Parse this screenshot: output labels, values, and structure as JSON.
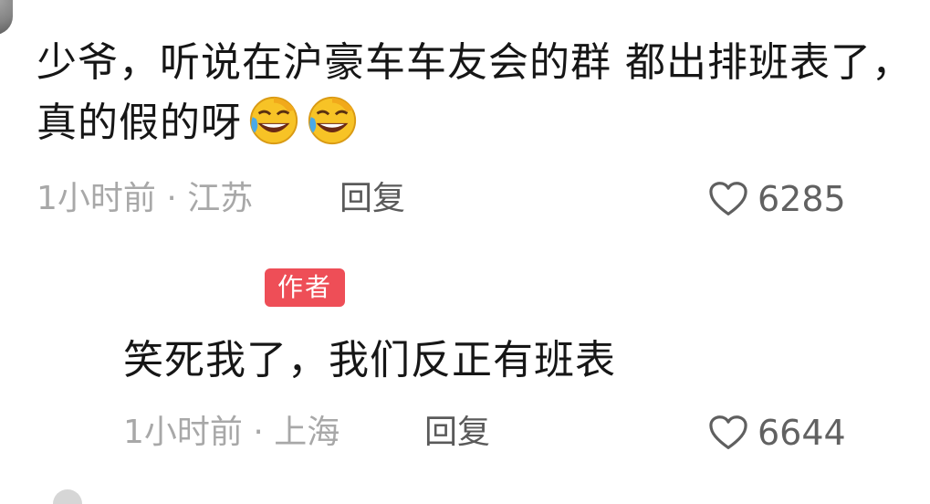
{
  "comment": {
    "text": "少爷，听说在沪豪车车友会的群 都出排班表了，真的假的呀",
    "emojis": [
      "rolling-on-floor-laughing",
      "rolling-on-floor-laughing"
    ],
    "time_location": "1小时前 · 江苏",
    "reply_label": "回复",
    "likes": "6285"
  },
  "author_reply": {
    "tag": "作者",
    "text": "笑死我了，我们反正有班表",
    "time_location": "1小时前 · 上海",
    "reply_label": "回复",
    "likes": "6644"
  },
  "colors": {
    "author_tag": "#ee4e57",
    "meta_text": "#a8a8a8",
    "main_text": "#161616"
  }
}
